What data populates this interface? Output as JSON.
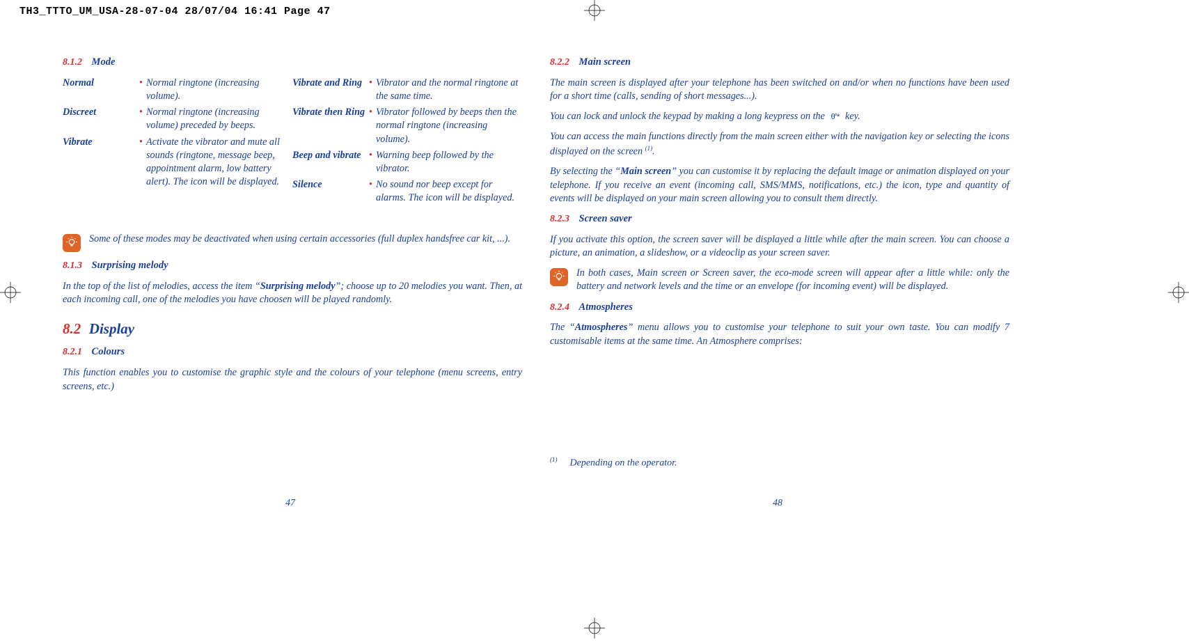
{
  "header_slug": "TH3_TTTO_UM_USA-28-07-04  28/07/04  16:41  Page 47",
  "left": {
    "sec_812_num": "8.1.2",
    "sec_812_title": "Mode",
    "modes_col1": [
      {
        "label": "Normal",
        "desc": "Normal ringtone (increasing volume)."
      },
      {
        "label": "Discreet",
        "desc": "Normal ringtone (increasing volume) preceded by beeps."
      },
      {
        "label": "Vibrate",
        "desc": "Activate the vibrator and mute all sounds (ringtone, message beep, appointment alarm, low battery alert). The        icon will be displayed."
      }
    ],
    "modes_col2": [
      {
        "label": "Vibrate and Ring",
        "desc": "Vibrator and the normal ringtone at the same time."
      },
      {
        "label": "Vibrate then Ring",
        "desc": "Vibrator followed by beeps then the normal ringtone (increasing volume)."
      },
      {
        "label": "Beep and vibrate",
        "desc": "Warning beep followed by the vibrator."
      },
      {
        "label": "Silence",
        "desc": "No sound nor beep except for alarms. The        icon will be displayed."
      }
    ],
    "tip_text": "Some of these modes may be deactivated when using certain accessories (full duplex handsfree car kit, ...).",
    "sec_813_num": "8.1.3",
    "sec_813_title": "Surprising melody",
    "para_813_a": "In the top of the list of melodies, access the item “",
    "para_813_b": "Surprising melody",
    "para_813_c": "”; choose up to 20 melodies you want. Then, at each incoming call, one of the melodies you have choosen will be played randomly.",
    "sec_82_num": "8.2",
    "sec_82_title": "Display",
    "sec_821_num": "8.2.1",
    "sec_821_title": "Colours",
    "para_821": "This function enables you to customise the graphic style and the colours of your telephone (menu screens, entry screens, etc.)",
    "page_num": "47"
  },
  "right": {
    "sec_822_num": "8.2.2",
    "sec_822_title": "Main screen",
    "para_822_1": "The main screen is displayed after your telephone has been switched on and/or when no functions have been used for a short time (calls, sending of short messages...).",
    "para_822_2a": "You can lock and unlock the keypad by making a long keypress on the ",
    "para_822_2b": " key.",
    "para_822_3a": "You can access the main functions directly from the main screen either with the navigation key or selecting the icons displayed on the screen ",
    "para_822_3b": ".",
    "para_822_4a": "By selecting the “",
    "para_822_4b": "Main screen",
    "para_822_4c": "” you can customise it by replacing the default image or animation displayed on your telephone. If you receive an event (incoming call, SMS/MMS, notifications, etc.) the icon, type and quantity of events will be displayed on your main screen allowing you to consult them directly.",
    "sec_823_num": "8.2.3",
    "sec_823_title": "Screen saver",
    "para_823": "If you activate this option, the screen saver will be displayed a little while after the main screen. You can choose a picture, an animation, a slideshow, or a videoclip as your screen saver.",
    "tip_text": "In both cases, Main screen or Screen saver, the eco-mode screen will appear after a little while: only the battery and network levels and the time or an envelope (for incoming event) will be displayed.",
    "sec_824_num": "8.2.4",
    "sec_824_title": "Atmospheres",
    "para_824_a": "The “",
    "para_824_b": "Atmospheres",
    "para_824_c": "” menu allows you to customise your telephone to suit your own taste. You can modify 7 customisable items at the same time. An Atmosphere comprises:",
    "footnote_sup": "(1)",
    "footnote_text": "Depending on the operator.",
    "page_num": "48"
  },
  "key_glyph": "θ°*"
}
